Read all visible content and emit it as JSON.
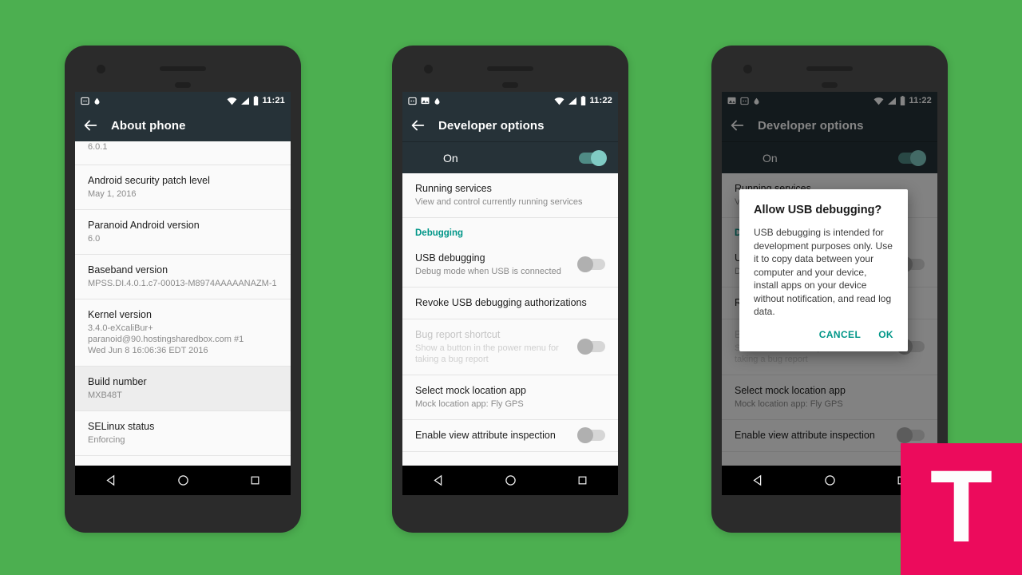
{
  "theme": {
    "background": "#4CAF50",
    "phone_body": "#2b2b2b",
    "appbar": "#263238",
    "accent_teal": "#009688",
    "switch_on": "#80cbc4",
    "watermark_pink": "#ec0b5c"
  },
  "watermark": {
    "letter": "T"
  },
  "navbar": {
    "back": "back-triangle",
    "home": "home-circle",
    "recents": "recents-square"
  },
  "phone1": {
    "statusbar": {
      "icons": [
        "notification-badge-icon",
        "droplet-icon"
      ],
      "wifi": "wifi-icon",
      "signal": "signal-icon",
      "battery": "battery-icon",
      "time": "11:21"
    },
    "appbar": {
      "back": "back-arrow-icon",
      "title": "About phone"
    },
    "rows": [
      {
        "t1": "",
        "t2": "6.0.1",
        "clipped": true,
        "highlight": false
      },
      {
        "t1": "Android security patch level",
        "t2": "May 1, 2016",
        "highlight": false
      },
      {
        "t1": "Paranoid Android version",
        "t2": "6.0",
        "highlight": false
      },
      {
        "t1": "Baseband version",
        "t2": "MPSS.DI.4.0.1.c7-00013-M8974AAAAANAZM-1",
        "highlight": false
      },
      {
        "t1": "Kernel version",
        "t2": "3.4.0-eXcaliBur+\nparanoid@90.hostingsharedbox.com #1\nWed Jun 8 16:06:36 EDT 2016",
        "highlight": false
      },
      {
        "t1": "Build number",
        "t2": "MXB48T",
        "highlight": true
      },
      {
        "t1": "SELinux status",
        "t2": "Enforcing",
        "highlight": false
      }
    ]
  },
  "phone2": {
    "statusbar": {
      "icons": [
        "notification-badge-icon",
        "image-icon",
        "droplet-icon"
      ],
      "wifi": "wifi-icon",
      "signal": "signal-icon",
      "battery": "battery-icon",
      "time": "11:22"
    },
    "appbar": {
      "back": "back-arrow-icon",
      "title": "Developer options"
    },
    "master_switch": {
      "label": "On",
      "state": "on"
    },
    "rows": [
      {
        "kind": "item",
        "t1": "Running services",
        "t2": "View and control currently running services",
        "toggle": null,
        "disabled": false
      },
      {
        "kind": "section",
        "label": "Debugging"
      },
      {
        "kind": "item",
        "t1": "USB debugging",
        "t2": "Debug mode when USB is connected",
        "toggle": "off",
        "disabled": false
      },
      {
        "kind": "item",
        "t1": "Revoke USB debugging authorizations",
        "t2": "",
        "toggle": null,
        "disabled": false
      },
      {
        "kind": "item",
        "t1": "Bug report shortcut",
        "t2": "Show a button in the power menu for taking a bug report",
        "toggle": "off",
        "disabled": true
      },
      {
        "kind": "item",
        "t1": "Select mock location app",
        "t2": "Mock location app: Fly GPS",
        "toggle": null,
        "disabled": false
      },
      {
        "kind": "item",
        "t1": "Enable view attribute inspection",
        "t2": "",
        "toggle": "off",
        "disabled": false
      }
    ]
  },
  "phone3": {
    "statusbar": {
      "icons": [
        "image-icon",
        "notification-badge-icon",
        "droplet-icon"
      ],
      "wifi": "wifi-icon",
      "signal": "signal-icon",
      "battery": "battery-icon",
      "time": "11:22"
    },
    "appbar": {
      "back": "back-arrow-icon",
      "title": "Developer options"
    },
    "master_switch": {
      "label": "On",
      "state": "on"
    },
    "rows": [
      {
        "kind": "item",
        "t1": "Running services",
        "t2": "View and control currently running services",
        "toggle": null,
        "disabled": false
      },
      {
        "kind": "section",
        "label": "Debugging"
      },
      {
        "kind": "item",
        "t1": "USB debugging",
        "t2": "Debug mode when USB is connected",
        "toggle": "off",
        "disabled": false
      },
      {
        "kind": "item",
        "t1": "Revoke USB debugging authorizations",
        "t2": "",
        "toggle": null,
        "disabled": false
      },
      {
        "kind": "item",
        "t1": "Bug report shortcut",
        "t2": "Show a button in the power menu for taking a bug report",
        "toggle": "off",
        "disabled": true
      },
      {
        "kind": "item",
        "t1": "Select mock location app",
        "t2": "Mock location app: Fly GPS",
        "toggle": null,
        "disabled": false
      },
      {
        "kind": "item",
        "t1": "Enable view attribute inspection",
        "t2": "",
        "toggle": "off",
        "disabled": false
      }
    ],
    "dialog": {
      "title": "Allow USB debugging?",
      "body": "USB debugging is intended for development purposes only. Use it to copy data between your computer and your device, install apps on your device without notification, and read log data.",
      "cancel": "CANCEL",
      "ok": "OK"
    }
  }
}
